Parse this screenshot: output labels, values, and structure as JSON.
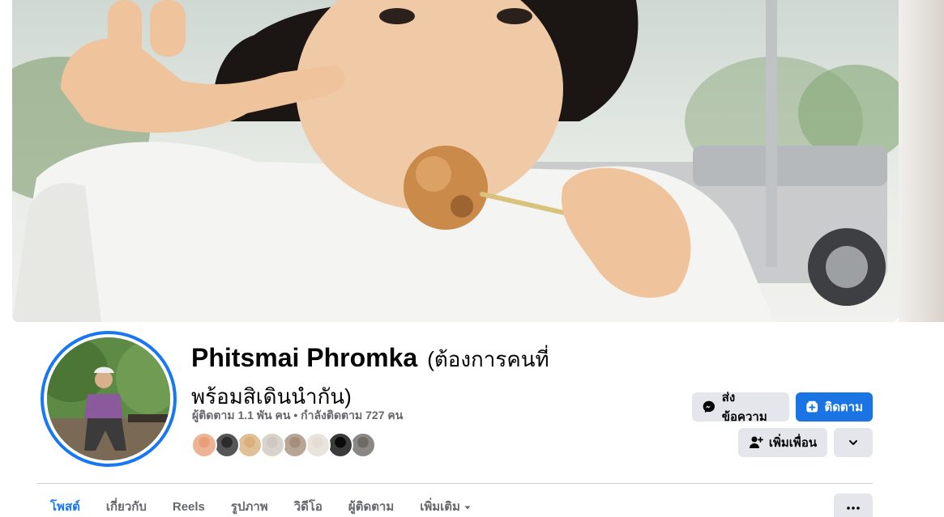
{
  "profile": {
    "name": "Phitsmai Phromka",
    "nickname": "(ต้องการคนที่พร้อมสิเดินนำกัน)",
    "stats": "ผู้ติดตาม 1.1 พัน คน • กำลังติดตาม 727 คน"
  },
  "actions": {
    "message_label": "ส่งข้อความ",
    "follow_label": "ติดตาม",
    "add_friend_label": "เพิ่มเพื่อน"
  },
  "tabs": [
    {
      "label": "โพสต์",
      "active": true
    },
    {
      "label": "เกี่ยวกับ",
      "active": false
    },
    {
      "label": "Reels",
      "active": false
    },
    {
      "label": "รูปภาพ",
      "active": false
    },
    {
      "label": "วิดีโอ",
      "active": false
    },
    {
      "label": "ผู้ติดตาม",
      "active": false
    },
    {
      "label": "เพิ่มเติม",
      "active": false
    }
  ],
  "friend_avatar_colors": [
    "#e8a07a",
    "#2b2b2b",
    "#d9b07c",
    "#cfc8c0",
    "#a58f7b",
    "#e3ddd5",
    "#0a0a0a",
    "#6e6a66"
  ],
  "colors": {
    "accent": "#1877f2",
    "follow_button": "#1b74e4",
    "secondary_button": "#e4e6eb",
    "muted_text": "#65676b"
  },
  "icons": {
    "message": "messenger-icon",
    "follow": "follow-plus-icon",
    "add_friend": "add-friend-icon",
    "expand": "chevron-down-icon",
    "more": "more-dots-icon",
    "tab_dropdown": "caret-down-icon"
  }
}
